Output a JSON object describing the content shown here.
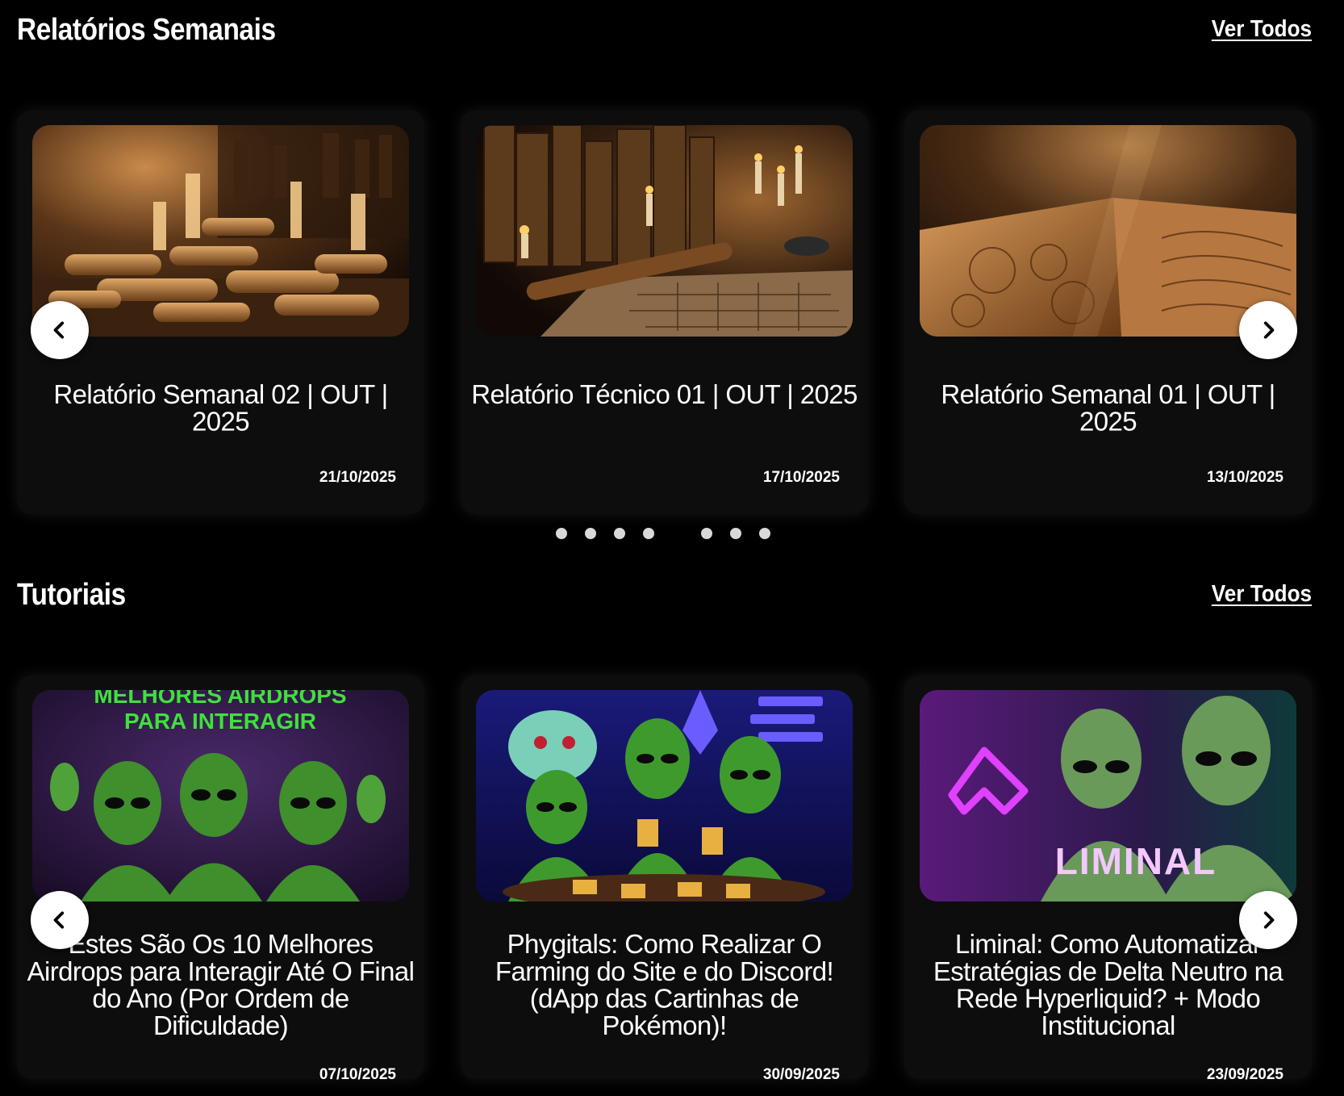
{
  "weekly": {
    "title": "Relatórios Semanais",
    "see_all": "Ver Todos",
    "cards": [
      {
        "title": "Relatório Semanal 02 | OUT | 2025",
        "date": "21/10/2025",
        "image": "scrolls-candlelight"
      },
      {
        "title": "Relatório Técnico 01 | OUT | 2025",
        "date": "17/10/2025",
        "image": "books-candles-runes"
      },
      {
        "title": "Relatório Semanal 01 | OUT | 2025",
        "date": "13/10/2025",
        "image": "open-ancient-book"
      }
    ],
    "prev_icon": "chevron-left-icon",
    "next_icon": "chevron-right-icon",
    "dots": 7
  },
  "tutorials": {
    "title": "Tutoriais",
    "see_all": "Ver Todos",
    "cards": [
      {
        "title": "Estes São Os 10 Melhores Airdrops para Interagir Até O Final do Ano (Por Ordem de Dificuldade)",
        "date": "07/10/2025",
        "image_text_1": "MELHORES AIRDROPS",
        "image_text_2": "PARA INTERAGIR"
      },
      {
        "title": "Phygitals: Como Realizar O Farming do Site e do Discord! (dApp das Cartinhas de Pokémon)!",
        "date": "30/09/2025",
        "image": "aliens-playing-cards"
      },
      {
        "title": "Liminal: Como Automatizar Estratégias de Delta Neutro na Rede Hyperliquid? + Modo Institucional",
        "date": "23/09/2025",
        "image_text": "LIMINAL"
      }
    ],
    "prev_icon": "chevron-left-icon",
    "next_icon": "chevron-right-icon"
  }
}
